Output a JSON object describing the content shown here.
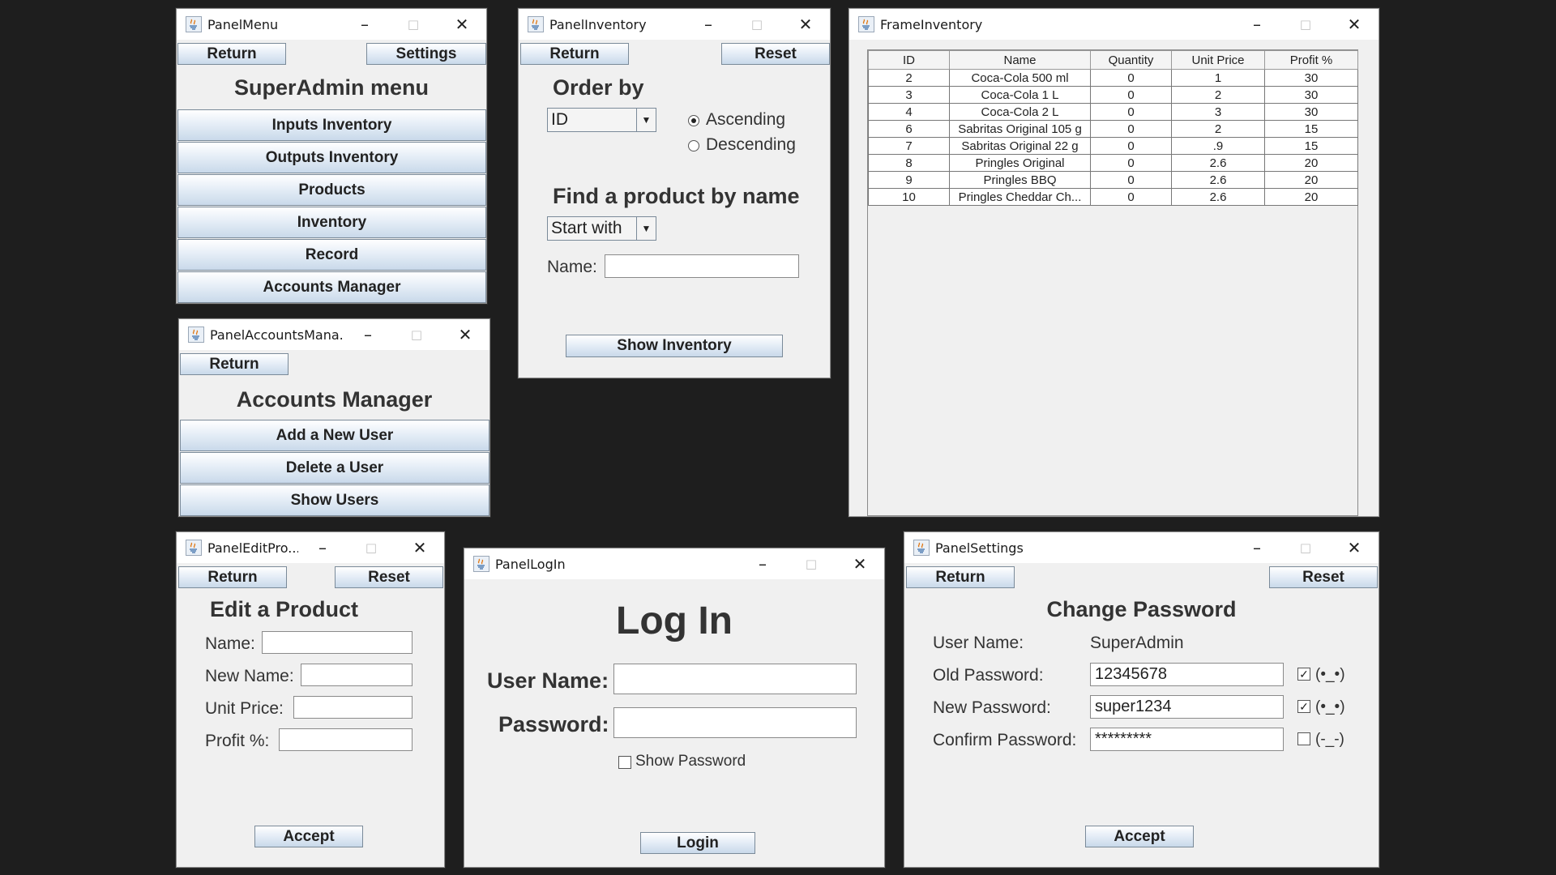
{
  "panel_menu": {
    "title": "PanelMenu",
    "return_label": "Return",
    "settings_label": "Settings",
    "heading": "SuperAdmin menu",
    "items": [
      "Inputs Inventory",
      "Outputs Inventory",
      "Products",
      "Inventory",
      "Record",
      "Accounts Manager"
    ]
  },
  "panel_inventory": {
    "title": "PanelInventory",
    "return_label": "Return",
    "reset_label": "Reset",
    "order_by_label": "Order by",
    "order_by_value": "ID",
    "ascending_label": "Ascending",
    "descending_label": "Descending",
    "find_label": "Find a product by name",
    "match_mode_value": "Start with",
    "name_label": "Name:",
    "name_value": "",
    "show_inventory_label": "Show Inventory"
  },
  "frame_inventory": {
    "title": "FrameInventory",
    "columns": [
      "ID",
      "Name",
      "Quantity",
      "Unit Price",
      "Profit %"
    ],
    "rows": [
      [
        "2",
        "Coca-Cola 500 ml",
        "0",
        "1",
        "30"
      ],
      [
        "3",
        "Coca-Cola 1 L",
        "0",
        "2",
        "30"
      ],
      [
        "4",
        "Coca-Cola 2 L",
        "0",
        "3",
        "30"
      ],
      [
        "6",
        "Sabritas Original 105 g",
        "0",
        "2",
        "15"
      ],
      [
        "7",
        "Sabritas Original 22 g",
        "0",
        ".9",
        "15"
      ],
      [
        "8",
        "Pringles Original",
        "0",
        "2.6",
        "20"
      ],
      [
        "9",
        "Pringles BBQ",
        "0",
        "2.6",
        "20"
      ],
      [
        "10",
        "Pringles Cheddar Ch...",
        "0",
        "2.6",
        "20"
      ]
    ]
  },
  "panel_accounts": {
    "title": "PanelAccountsMana...",
    "return_label": "Return",
    "heading": "Accounts Manager",
    "items": [
      "Add a New User",
      "Delete a User",
      "Show Users"
    ]
  },
  "panel_edit": {
    "title": "PanelEditPro...",
    "return_label": "Return",
    "reset_label": "Reset",
    "heading": "Edit a Product",
    "name_label": "Name:",
    "new_name_label": "New Name:",
    "unit_price_label": "Unit Price:",
    "profit_label": "Profit %:",
    "accept_label": "Accept"
  },
  "panel_login": {
    "title": "PanelLogIn",
    "heading": "Log In",
    "user_label": "User Name:",
    "password_label": "Password:",
    "show_password_label": "Show Password",
    "login_label": "Login"
  },
  "panel_settings": {
    "title": "PanelSettings",
    "return_label": "Return",
    "reset_label": "Reset",
    "heading": "Change Password",
    "user_name_label": "User Name:",
    "user_name_value": "SuperAdmin",
    "old_password_label": "Old Password:",
    "old_password_value": "12345678",
    "new_password_label": "New Password:",
    "new_password_value": "super1234",
    "confirm_password_label": "Confirm Password:",
    "confirm_password_value": "*********",
    "show_open": "(•_•)",
    "show_closed": "(-_-)",
    "accept_label": "Accept"
  },
  "window_controls": {
    "minimize": "–",
    "maximize": "□",
    "close": "✕"
  }
}
